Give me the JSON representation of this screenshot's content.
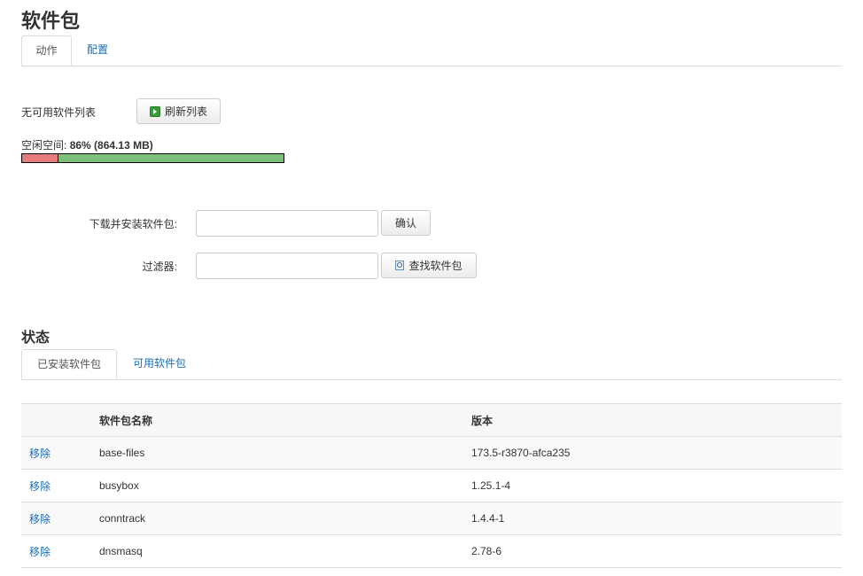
{
  "page": {
    "title": "软件包"
  },
  "tabs": [
    {
      "label": "动作",
      "active": true
    },
    {
      "label": "配置",
      "active": false
    }
  ],
  "actions": {
    "no_list_text": "无可用软件列表",
    "refresh_label": "刷新列表",
    "free_space_label": "空闲空间:",
    "free_space_value": "86% (864.13 MB)",
    "free_fraction": 0.86
  },
  "install": {
    "label": "下载并安装软件包:",
    "value": "",
    "confirm_label": "确认"
  },
  "filter": {
    "label": "过滤器:",
    "value": "",
    "search_label": "查找软件包"
  },
  "status": {
    "title": "状态",
    "tabs": [
      {
        "label": "已安装软件包",
        "active": true
      },
      {
        "label": "可用软件包",
        "active": false
      }
    ],
    "table": {
      "headers": [
        "",
        "软件包名称",
        "版本"
      ],
      "rows": [
        {
          "action": "移除",
          "name": "base-files",
          "version": "173.5-r3870-afca235"
        },
        {
          "action": "移除",
          "name": "busybox",
          "version": "1.25.1-4"
        },
        {
          "action": "移除",
          "name": "conntrack",
          "version": "1.4.4-1"
        },
        {
          "action": "移除",
          "name": "dnsmasq",
          "version": "2.78-6"
        }
      ]
    }
  },
  "colors": {
    "link": "#1a6eb5",
    "used": "#e77b7b",
    "free": "#7cc07c"
  }
}
